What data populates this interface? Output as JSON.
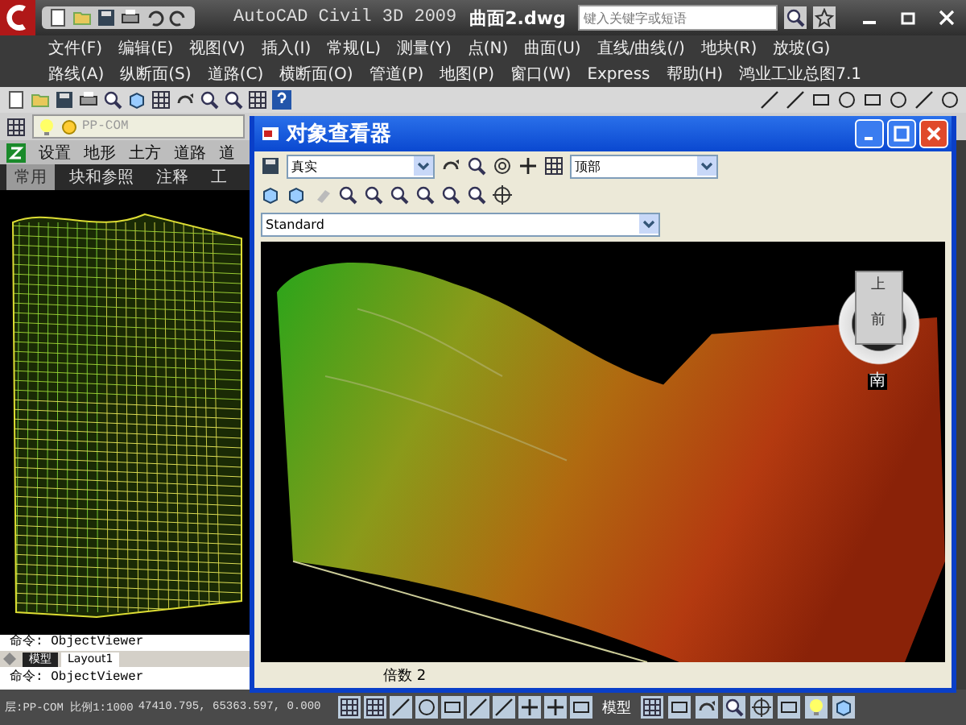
{
  "app": {
    "title": "AutoCAD Civil 3D 2009",
    "document": "曲面2.dwg",
    "search": {
      "placeholder": "键入关键字或短语"
    }
  },
  "menus": [
    [
      "文件(F)",
      "编辑(E)",
      "视图(V)",
      "插入(I)",
      "常规(L)",
      "测量(Y)",
      "点(N)",
      "曲面(U)",
      "直线/曲线(/)",
      "地块(R)",
      "放坡(G)"
    ],
    [
      "路线(A)",
      "纵断面(S)",
      "道路(C)",
      "横断面(O)",
      "管道(P)",
      "地图(P)",
      "窗口(W)",
      "Express",
      "帮助(H)",
      "鸿业工业总图7.1"
    ]
  ],
  "layer": {
    "name": "PP-COM"
  },
  "ribbon_menu": [
    "设置",
    "地形",
    "土方",
    "道路",
    "道"
  ],
  "ribbon_tabs": [
    {
      "label": "常用",
      "selected": true
    },
    {
      "label": "块和参照",
      "selected": false
    },
    {
      "label": "注释",
      "selected": false
    },
    {
      "label": "工",
      "selected": false
    }
  ],
  "command_lines": [
    "命令: ObjectViewer",
    "命令: ObjectViewer"
  ],
  "layout_tabs": [
    {
      "label": "模型",
      "selected": true
    },
    {
      "label": "Layout1",
      "selected": false
    }
  ],
  "viewer": {
    "title": "对象查看器",
    "visual_style": "真实",
    "view": "顶部",
    "style": "Standard",
    "cube": {
      "top": "上",
      "front": "前",
      "compass": "南"
    },
    "status": "倍数 2"
  },
  "status_bar": {
    "layer": "层:PP-COM 比例1:1000",
    "coords": "47410.795, 65363.597, 0.000",
    "model": "模型"
  }
}
